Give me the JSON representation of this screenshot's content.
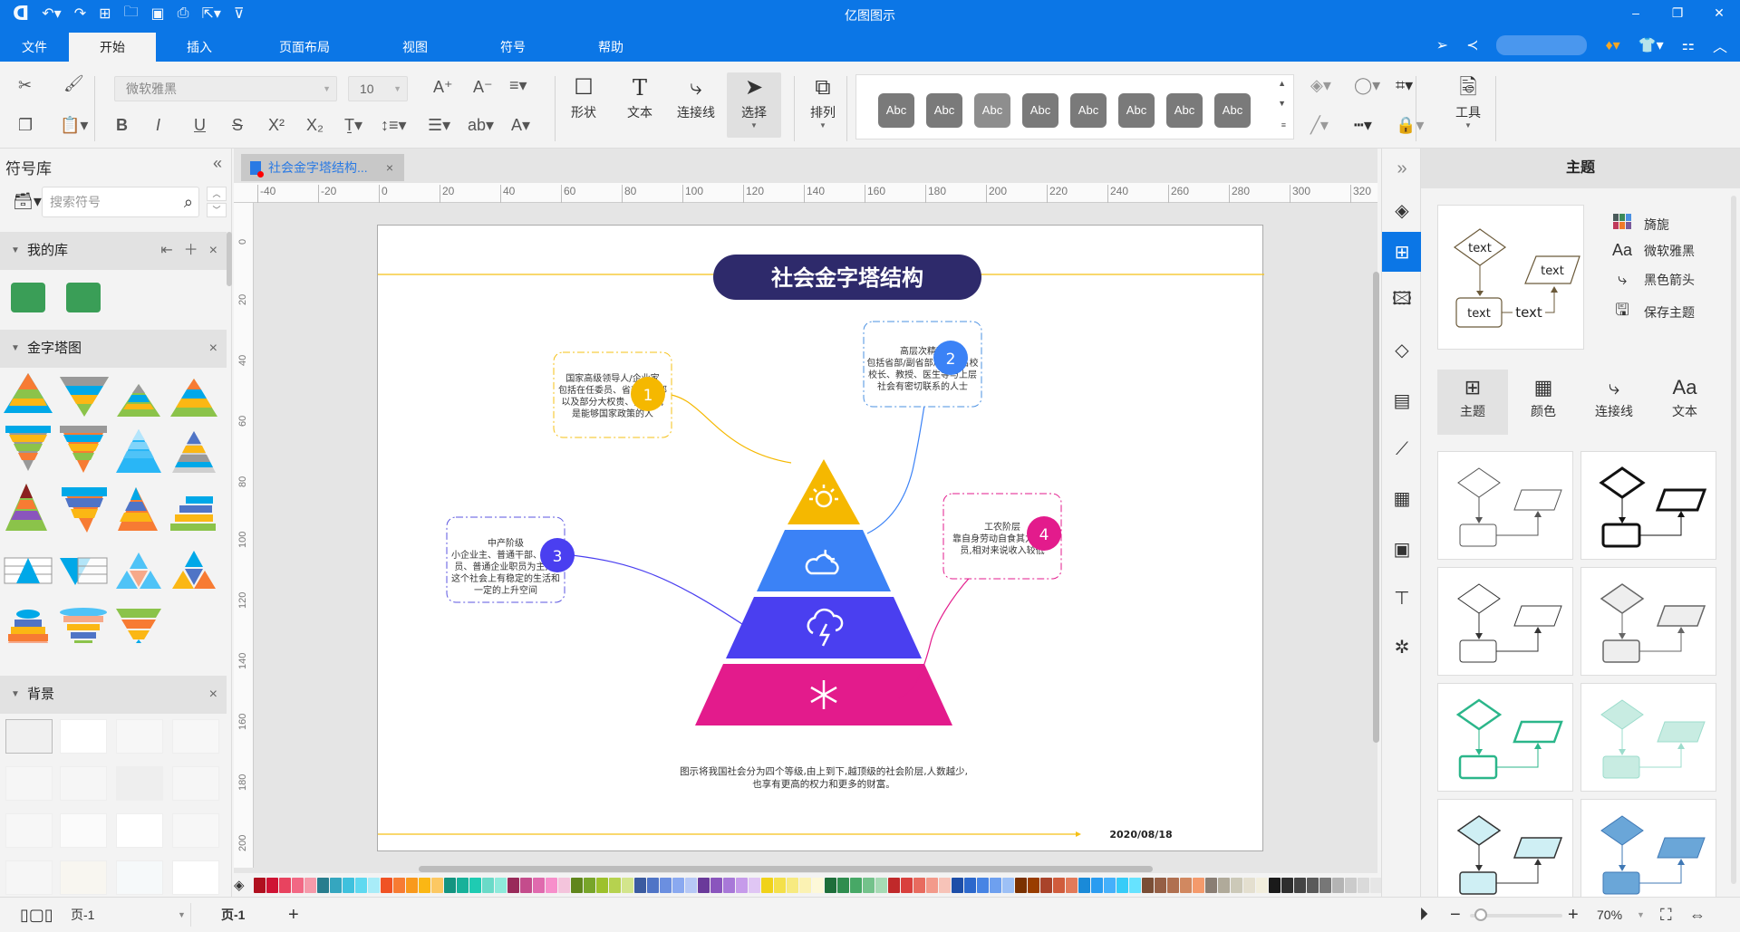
{
  "app": {
    "title": "亿图图示",
    "quick_access": [
      "logo-icon",
      "undo-icon",
      "redo-icon",
      "new-icon",
      "open-icon",
      "save-icon",
      "print-icon",
      "export-icon",
      "customize-icon"
    ],
    "window_controls": {
      "minimize": "–",
      "restore": "❐",
      "close": "✕"
    }
  },
  "menu": {
    "items": [
      {
        "label": "文件",
        "active": false
      },
      {
        "label": "开始",
        "active": true
      },
      {
        "label": "插入",
        "active": false
      },
      {
        "label": "页面布局",
        "active": false
      },
      {
        "label": "视图",
        "active": false
      },
      {
        "label": "符号",
        "active": false
      },
      {
        "label": "帮助",
        "active": false
      }
    ]
  },
  "ribbon": {
    "font_family": "微软雅黑",
    "font_size": "10",
    "tools": {
      "shape": "形状",
      "text": "文本",
      "connector": "连接线",
      "select": "选择",
      "arrange": "排列",
      "tools": "工具"
    },
    "style_gallery": [
      "Abc",
      "Abc",
      "Abc",
      "Abc",
      "Abc",
      "Abc",
      "Abc",
      "Abc"
    ],
    "style_colors": [
      "#7a7a7a",
      "#7a7a7a",
      "#8e8e8e",
      "#7a7a7a",
      "#7a7a7a",
      "#7a7a7a",
      "#7a7a7a",
      "#7a7a7a"
    ]
  },
  "left_panel": {
    "title": "符号库",
    "search_placeholder": "搜索符号",
    "sections": [
      {
        "label": "我的库"
      },
      {
        "label": "金字塔图"
      },
      {
        "label": "背景"
      }
    ]
  },
  "document": {
    "tab_label": "社会金字塔结构...",
    "h_ruler": [
      "-40",
      "-20",
      "0",
      "20",
      "40",
      "60",
      "80",
      "100",
      "120",
      "140",
      "160",
      "180",
      "200",
      "220",
      "240",
      "260",
      "280",
      "300",
      "320"
    ],
    "v_ruler": [
      "0",
      "20",
      "40",
      "60",
      "80",
      "100",
      "120",
      "140",
      "160",
      "180",
      "200"
    ],
    "diagram": {
      "title": "社会金字塔结构",
      "title_bg": "#2e2a6b",
      "accent_line": "#f5c016",
      "layers": [
        {
          "num": "1",
          "color": "#f5b800",
          "icon": "sun-icon",
          "heading": "国家高级领导人/企业家",
          "body": [
            "包括在任委员、省部级干部",
            "以及部分大权贵、大富商,",
            "是能够国家政策的人"
          ]
        },
        {
          "num": "2",
          "color": "#3b82f6",
          "icon": "cloud-moon-icon",
          "heading": "高层次精英",
          "body": [
            "包括省部/副省部局级、名校",
            "校长、教授、医生等与上层",
            "社会有密切联系的人士"
          ]
        },
        {
          "num": "3",
          "color": "#4a3ff0",
          "icon": "storm-icon",
          "heading": "中产阶级",
          "body": [
            "小企业主、普通干部、公务",
            "员、普通企业职员为主,在",
            "这个社会上有稳定的生活和",
            "一定的上升空间"
          ]
        },
        {
          "num": "4",
          "color": "#e31b8c",
          "icon": "snowflake-icon",
          "heading": "工农阶层",
          "body": [
            "靠自身劳动自食其力的人",
            "员,相对来说收入较低"
          ]
        }
      ],
      "caption": [
        "图示将我国社会分为四个等级,由上到下,越顶级的社会阶层,人数越少,",
        "也享有更高的权力和更多的财富。"
      ],
      "date": "2020/08/18"
    }
  },
  "palette": [
    "#b0101f",
    "#cf1334",
    "#e8435f",
    "#f26884",
    "#f59aaa",
    "#287d8e",
    "#35a6bf",
    "#3fc1dd",
    "#5fd9f0",
    "#a8ecf8",
    "#f05224",
    "#f77b33",
    "#f9991c",
    "#fbb714",
    "#fcc862",
    "#139480",
    "#17b19a",
    "#1fcbb2",
    "#6adac8",
    "#8eeadb",
    "#992a5a",
    "#c44c8c",
    "#e06aae",
    "#f78fcb",
    "#f4c4dc",
    "#60861c",
    "#78a52a",
    "#9dc12c",
    "#b6d24f",
    "#d3e58c",
    "#3b5ba0",
    "#4f74c6",
    "#6b8fe0",
    "#8aa9f0",
    "#b6c8f6",
    "#6a3a9a",
    "#8a55bd",
    "#a878d8",
    "#c69bea",
    "#e0c6f4",
    "#f0d21a",
    "#f4e04a",
    "#f7ea80",
    "#fbf2b3",
    "#fdf8d8",
    "#1e6e3a",
    "#2f8d4f",
    "#47a866",
    "#74c28b",
    "#a6dab4",
    "#c0292a",
    "#d9403d",
    "#e86b5f",
    "#f39a8b",
    "#f7c3b8",
    "#1d4ea8",
    "#2c68cc",
    "#4784e4",
    "#6ea0ef",
    "#9dc0f6",
    "#7a3100",
    "#993d00",
    "#a9432a",
    "#d05c3c",
    "#e27a5a",
    "#1a8ad8",
    "#2a9cf0",
    "#45b0fb",
    "#36ccf8",
    "#66e3ff",
    "#7a4e36",
    "#955f45",
    "#b07050",
    "#d18860",
    "#f49a6c",
    "#8a7e74",
    "#b0aa9a",
    "#ccc9b8",
    "#e4dfcf",
    "#f2eedd",
    "#1a1a1a",
    "#2e2e2e",
    "#444444",
    "#5a5a5a",
    "#777777",
    "#b4b4b4",
    "#cbcbcb",
    "#dadada",
    "#e6e6e6",
    "#f2f2f2"
  ],
  "icon_bar": [
    "collapse-icon",
    "fill-icon",
    "theme-icon",
    "image-icon",
    "layers-icon",
    "page-list-icon",
    "chart-icon",
    "table-icon",
    "puzzle-icon",
    "org-icon",
    "mindmap-icon"
  ],
  "right_panel": {
    "title": "主题",
    "preview_labels": [
      "text",
      "text",
      "text",
      "text"
    ],
    "props": [
      {
        "icon": "palette-grid-icon",
        "label": "旖旎"
      },
      {
        "icon": "font-icon",
        "label": "微软雅黑"
      },
      {
        "icon": "connector-icon",
        "label": "黑色箭头"
      },
      {
        "icon": "save-icon",
        "label": "保存主题"
      }
    ],
    "tabs": [
      {
        "icon": "theme-icon",
        "label": "主题",
        "active": true
      },
      {
        "icon": "color-grid-icon",
        "label": "颜色",
        "active": false
      },
      {
        "icon": "connector-icon",
        "label": "连接线",
        "active": false
      },
      {
        "icon": "font-icon",
        "label": "文本",
        "active": false
      }
    ]
  },
  "status": {
    "page_select": "页-1",
    "page_tab": "页-1",
    "zoom": "70%",
    "zoom_fraction": 0.12
  }
}
